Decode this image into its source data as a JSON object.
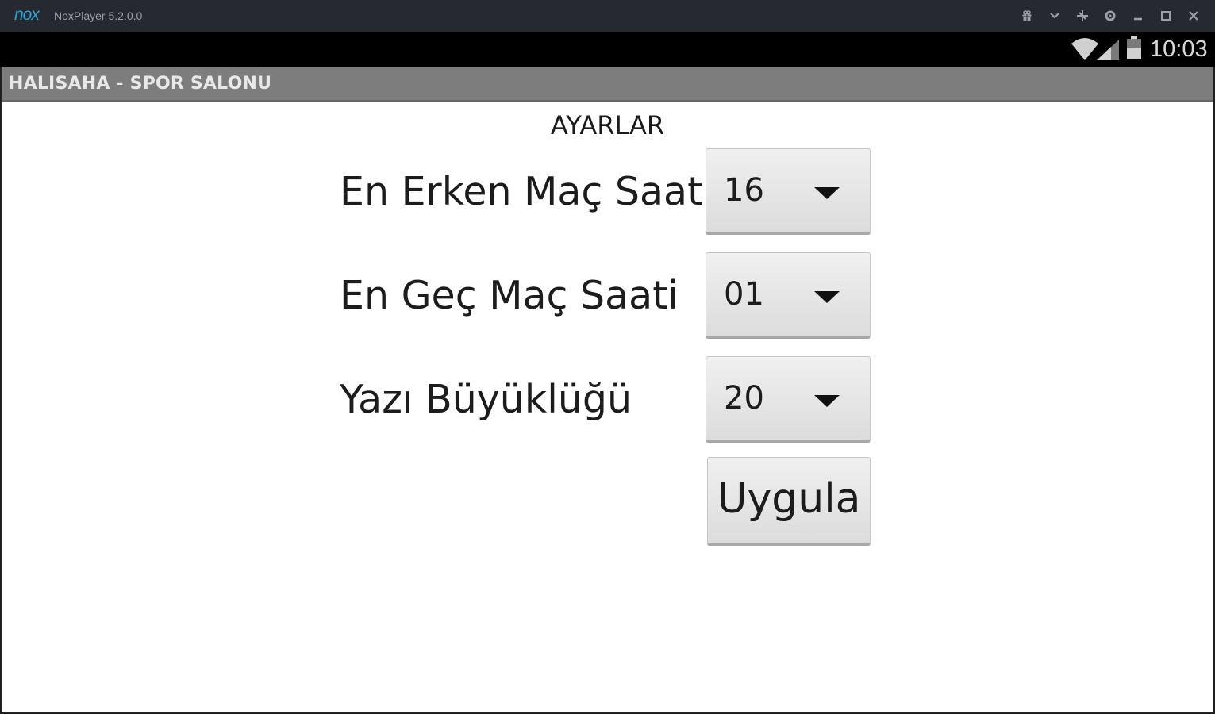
{
  "window": {
    "logo": "nox",
    "title": "NoxPlayer 5.2.0.0",
    "controls": [
      {
        "name": "gift-icon"
      },
      {
        "name": "chevron-down-icon"
      },
      {
        "name": "pin-icon"
      },
      {
        "name": "gear-icon"
      },
      {
        "name": "minimize-icon"
      },
      {
        "name": "maximize-icon"
      },
      {
        "name": "close-icon"
      }
    ]
  },
  "status_bar": {
    "time": "10:03",
    "icons": [
      "wifi-icon",
      "signal-icon",
      "battery-icon"
    ]
  },
  "app_bar": {
    "title": "HALISAHA - SPOR SALONU"
  },
  "settings": {
    "heading": "AYARLAR",
    "rows": [
      {
        "label": "En Erken Maç Saati",
        "value": "16"
      },
      {
        "label": "En Geç Maç Saati",
        "value": "01"
      },
      {
        "label": "Yazı Büyüklüğü",
        "value": "20"
      }
    ],
    "apply_label": "Uygula"
  },
  "colors": {
    "nox_blue": "#2aa6d6",
    "titlebar_bg": "#262a30",
    "appbar_bg": "#7d7d7d"
  }
}
